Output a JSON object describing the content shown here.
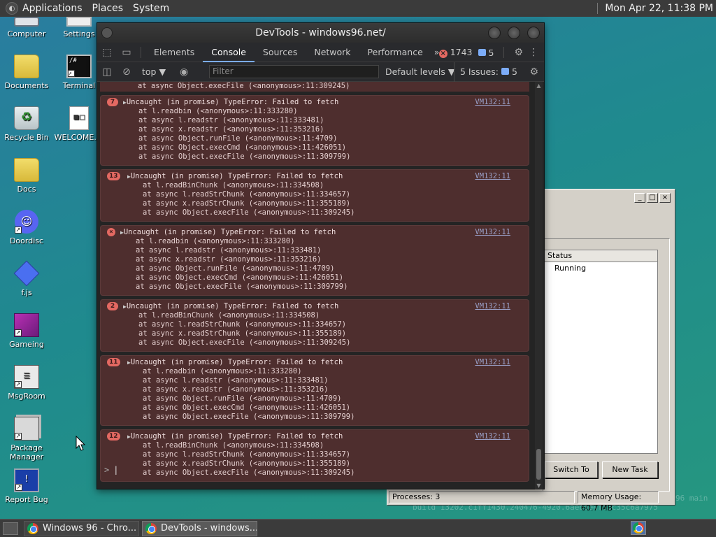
{
  "top_panel": {
    "menus": [
      "Applications",
      "Places",
      "System"
    ],
    "clock": "Mon Apr 22, 11:38 PM"
  },
  "desktop": {
    "icons": [
      {
        "label": "Computer",
        "icon": "computer-icon"
      },
      {
        "label": "Settings",
        "icon": "settings-icon"
      },
      {
        "label": "Documents",
        "icon": "folder-icon"
      },
      {
        "label": "Terminal",
        "icon": "terminal-icon"
      },
      {
        "label": "Recycle Bin",
        "icon": "recycle-bin-icon"
      },
      {
        "label": "WELCOME....",
        "icon": "document-icon"
      },
      {
        "label": "Docs",
        "icon": "folder-icon"
      },
      {
        "label": "Doordisc",
        "icon": "discord-icon"
      },
      {
        "label": "f.js",
        "icon": "diamond-icon"
      },
      {
        "label": "Gameing",
        "icon": "cube-icon"
      },
      {
        "label": "MsgRoom",
        "icon": "msgroom-icon"
      },
      {
        "label": "Package Manager",
        "icon": "package-icon"
      },
      {
        "label": "Report Bug",
        "icon": "report-bug-icon"
      }
    ],
    "terminal_glyph": "/#",
    "doc_glyph": "■□",
    "msg_glyph": "☰",
    "bug_glyph": "!"
  },
  "taskmgr": {
    "column_status": "Status",
    "row_status": "Running",
    "switch_to": "Switch To",
    "new_task": "New Task",
    "processes": "Processes: 3",
    "memory": "Memory Usage: 60.7 MB",
    "ctrl_min": "_",
    "ctrl_max": "□",
    "ctrl_close": "×"
  },
  "build_text": "build 13202.c1ff1430.240476-4920.6aeb0e4fe8c35c6a7975",
  "build_text2": "96 main",
  "devtools": {
    "title": "DevTools - windows96.net/",
    "tabs": [
      "Elements",
      "Console",
      "Sources",
      "Network",
      "Performance"
    ],
    "more_tabs": "»",
    "error_count": "1743",
    "message_count": "5",
    "context": "top ▼",
    "filter_placeholder": "Filter",
    "levels": "Default levels ▼",
    "issues_label": "5 Issues:",
    "issues_count": "5",
    "top_stub": "at async Object.execFile (<anonymous>:11:309245)",
    "entries": [
      {
        "badge": "7",
        "source": "VM132:11",
        "head": "Uncaught (in promise) TypeError: Failed to fetch",
        "lines": [
          "at l.readbin (<anonymous>:11:333280)",
          "at async l.readstr (<anonymous>:11:333481)",
          "at async x.readstr (<anonymous>:11:353216)",
          "at async Object.runFile (<anonymous>:11:4709)",
          "at async Object.execCmd (<anonymous>:11:426051)",
          "at async Object.execFile (<anonymous>:11:309799)"
        ]
      },
      {
        "badge": "13",
        "source": "VM132:11",
        "head": "Uncaught (in promise) TypeError: Failed to fetch",
        "lines": [
          "at l.readBinChunk (<anonymous>:11:334508)",
          "at async l.readStrChunk (<anonymous>:11:334657)",
          "at async x.readStrChunk (<anonymous>:11:355189)",
          "at async Object.execFile (<anonymous>:11:309245)"
        ]
      },
      {
        "badge": "",
        "source": "VM132:11",
        "head": "Uncaught (in promise) TypeError: Failed to fetch",
        "lines": [
          "at l.readbin (<anonymous>:11:333280)",
          "at async l.readstr (<anonymous>:11:333481)",
          "at async x.readstr (<anonymous>:11:353216)",
          "at async Object.runFile (<anonymous>:11:4709)",
          "at async Object.execCmd (<anonymous>:11:426051)",
          "at async Object.execFile (<anonymous>:11:309799)"
        ]
      },
      {
        "badge": "2",
        "source": "VM132:11",
        "head": "Uncaught (in promise) TypeError: Failed to fetch",
        "lines": [
          "at l.readBinChunk (<anonymous>:11:334508)",
          "at async l.readStrChunk (<anonymous>:11:334657)",
          "at async x.readStrChunk (<anonymous>:11:355189)",
          "at async Object.execFile (<anonymous>:11:309245)"
        ]
      },
      {
        "badge": "11",
        "source": "VM132:11",
        "head": "Uncaught (in promise) TypeError: Failed to fetch",
        "lines": [
          "at l.readbin (<anonymous>:11:333280)",
          "at async l.readstr (<anonymous>:11:333481)",
          "at async x.readstr (<anonymous>:11:353216)",
          "at async Object.runFile (<anonymous>:11:4709)",
          "at async Object.execCmd (<anonymous>:11:426051)",
          "at async Object.execFile (<anonymous>:11:309799)"
        ]
      },
      {
        "badge": "12",
        "source": "VM132:11",
        "head": "Uncaught (in promise) TypeError: Failed to fetch",
        "lines": [
          "at l.readBinChunk (<anonymous>:11:334508)",
          "at async l.readStrChunk (<anonymous>:11:334657)",
          "at async x.readStrChunk (<anonymous>:11:355189)",
          "at async Object.execFile (<anonymous>:11:309245)"
        ]
      }
    ],
    "prompt": ">",
    "error_x": "×"
  },
  "taskbar": {
    "tasks": [
      {
        "label": "Windows 96 - Chro...",
        "active": false
      },
      {
        "label": "DevTools - windows...",
        "active": true
      }
    ]
  },
  "colors": {
    "error_bg": "#4e2e2e",
    "error_badge": "#e46962",
    "active_tab": "#7cacf8",
    "link": "#9aa0c8"
  }
}
